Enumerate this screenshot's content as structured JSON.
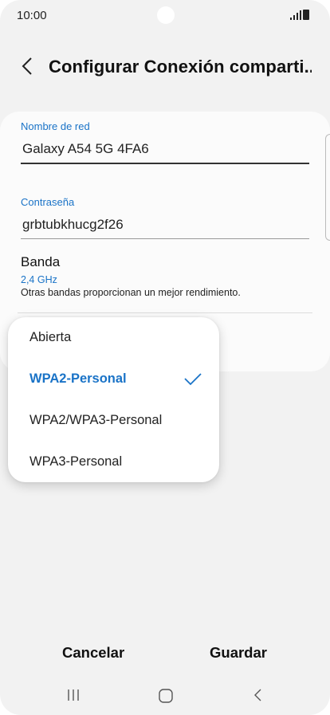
{
  "status_bar": {
    "time": "10:00"
  },
  "header": {
    "title": "Configurar Conexión comparti..."
  },
  "form": {
    "network_name_label": "Nombre de red",
    "network_name_value": "Galaxy A54 5G 4FA6",
    "password_label": "Contraseña",
    "password_value": "grbtubkhucg2f26",
    "band_title": "Banda",
    "band_value": "2,4 GHz",
    "band_description": "Otras bandas proporcionan un mejor rendimiento."
  },
  "security_dropdown": {
    "options": [
      {
        "label": "Abierta",
        "selected": false
      },
      {
        "label": "WPA2-Personal",
        "selected": true
      },
      {
        "label": "WPA2/WPA3-Personal",
        "selected": false
      },
      {
        "label": "WPA3-Personal",
        "selected": false
      }
    ]
  },
  "actions": {
    "cancel_label": "Cancelar",
    "save_label": "Guardar"
  },
  "nav_bar": {
    "icons": [
      "recent-apps-icon",
      "home-icon",
      "back-icon"
    ]
  },
  "colors": {
    "accent": "#1a73c7",
    "background": "#f2f2f2",
    "card": "#fbfbfb"
  }
}
